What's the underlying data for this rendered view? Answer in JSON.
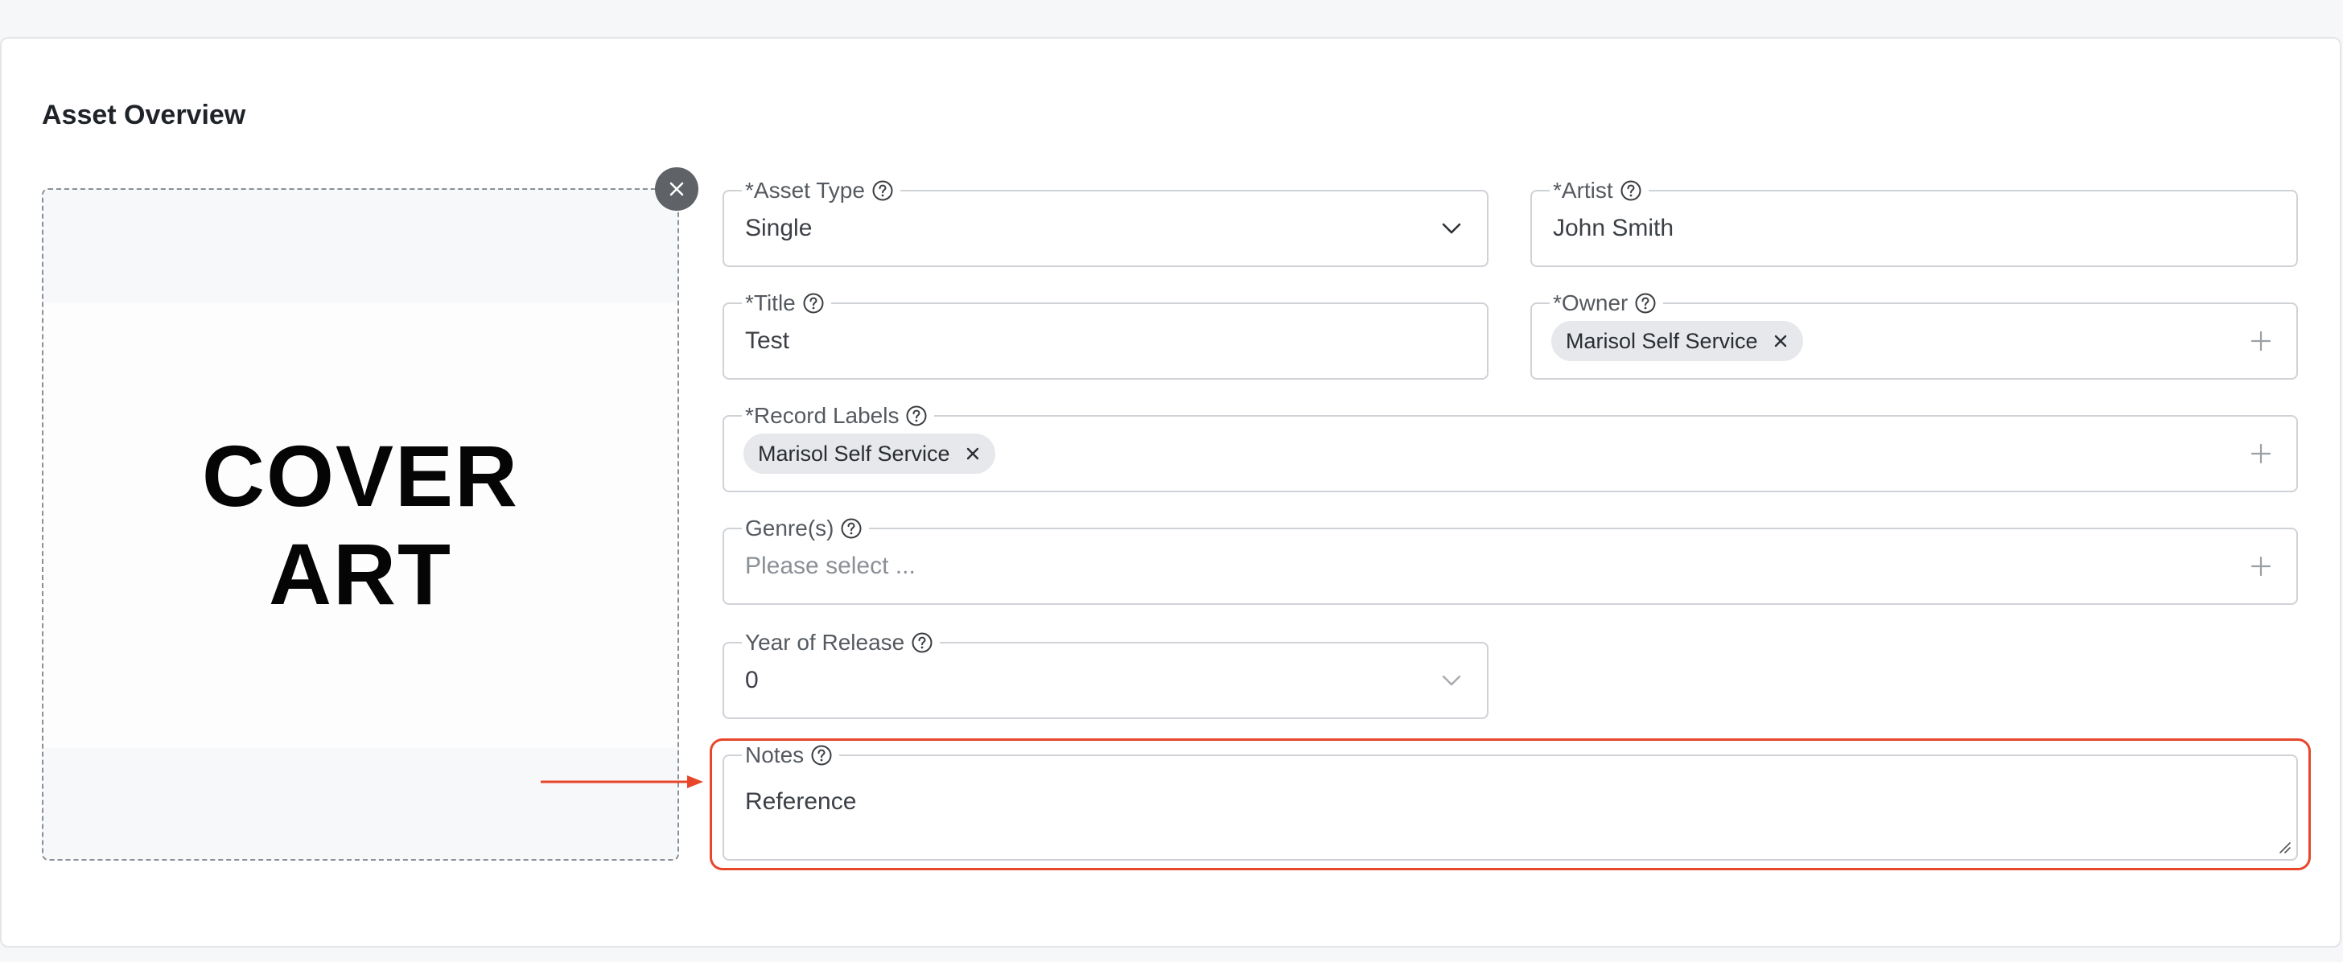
{
  "section": {
    "title": "Asset Overview"
  },
  "cover": {
    "line1": "COVER",
    "line2": "ART"
  },
  "fields": {
    "asset_type": {
      "label": "*Asset Type",
      "value": "Single"
    },
    "artist": {
      "label": "*Artist",
      "value": "John Smith"
    },
    "title": {
      "label": "*Title",
      "value": "Test"
    },
    "owner": {
      "label": "*Owner",
      "tag": "Marisol Self Service"
    },
    "record_labels": {
      "label": "*Record Labels",
      "tag": "Marisol Self Service"
    },
    "genres": {
      "label": "Genre(s)",
      "placeholder": "Please select ..."
    },
    "year_of_release": {
      "label": "Year of Release",
      "value": "0"
    },
    "notes": {
      "label": "Notes",
      "value": "Reference"
    }
  },
  "colors": {
    "highlight": "#e8462a",
    "tag_bg": "#e6e8eb",
    "border": "#cfd2d6"
  },
  "icons": [
    "close-icon",
    "help-icon",
    "chevron-down-icon",
    "plus-icon",
    "tag-remove-icon",
    "resize-handle-icon",
    "arrow-right-icon"
  ]
}
